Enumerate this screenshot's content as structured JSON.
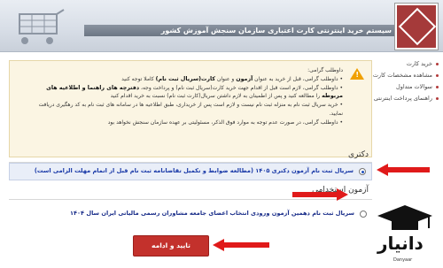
{
  "header": {
    "title": "سیستم خرید اینترنتی کارت اعتباری سازمان سنجش آموزش کشور"
  },
  "sidebar": {
    "items": [
      {
        "label": "خرید کارت"
      },
      {
        "label": "مشاهده مشخصات کارت"
      },
      {
        "label": "سوالات متداول"
      },
      {
        "label": "راهنمای پرداخت اینترنتی"
      }
    ]
  },
  "notice": {
    "greeting": "داوطلب گرامی:",
    "line1a": "داوطلب گرامی، قبل از خرید به عنوان ",
    "line1b": "آزمون",
    "line1c": " و عنوان ",
    "line1d": "کارت(سریال ثبت نام)",
    "line1e": " کاملا توجه کنید",
    "line2a": "داوطلب گرامی، لازم است قبل از اقدام جهت خرید کارت(سریال ثبت نام) و پرداخت وجه، ",
    "line2b": "دفترچه های راهنما و اطلاعیه های",
    "line3a": "مربوطه",
    "line3b": " را مطالعه کنید و پس از اطمینان به لازم داشتن سریال(کارت ثبت نام) نسبت به خرید اقدام کنید",
    "line4": "خرید سریال ثبت نام به منزله ثبت نام نیست و لازم است پس از خریداری، طبق اطلاعیه ها در سامانه های ثبت نام به کد رهگیری دریافت نمایید.",
    "line5": "داوطلب گرامی، در صورت عدم توجه به موارد فوق الذکر، مسئولیتی بر عهده سازمان سنجش نخواهد بود"
  },
  "section_doctoral": {
    "title": "دکتری",
    "option_label": "سریال ثبت نام آزمون دکتری ۱۴۰۵ (مطالعه ضوابط و تکمیل تقاضانامه ثبت نام قبل از اتمام مهلت الزامی است)"
  },
  "section_employment": {
    "title": "آزمون استخدامی",
    "option_label": "سریال ثبت نام دهمین آزمون ورودی انتخاب اعضای جامعه مشاوران رسمی مالیاتی ایران سال ۱۴۰۴"
  },
  "actions": {
    "confirm_label": "تایید و ادامه"
  },
  "watermark": {
    "brand": "دانیار",
    "sub": "Danyaar"
  },
  "colors": {
    "accent": "#c3312c",
    "arrow": "#e01a1a",
    "selected_bg": "#e9eef8",
    "warning": "#f0a000"
  }
}
